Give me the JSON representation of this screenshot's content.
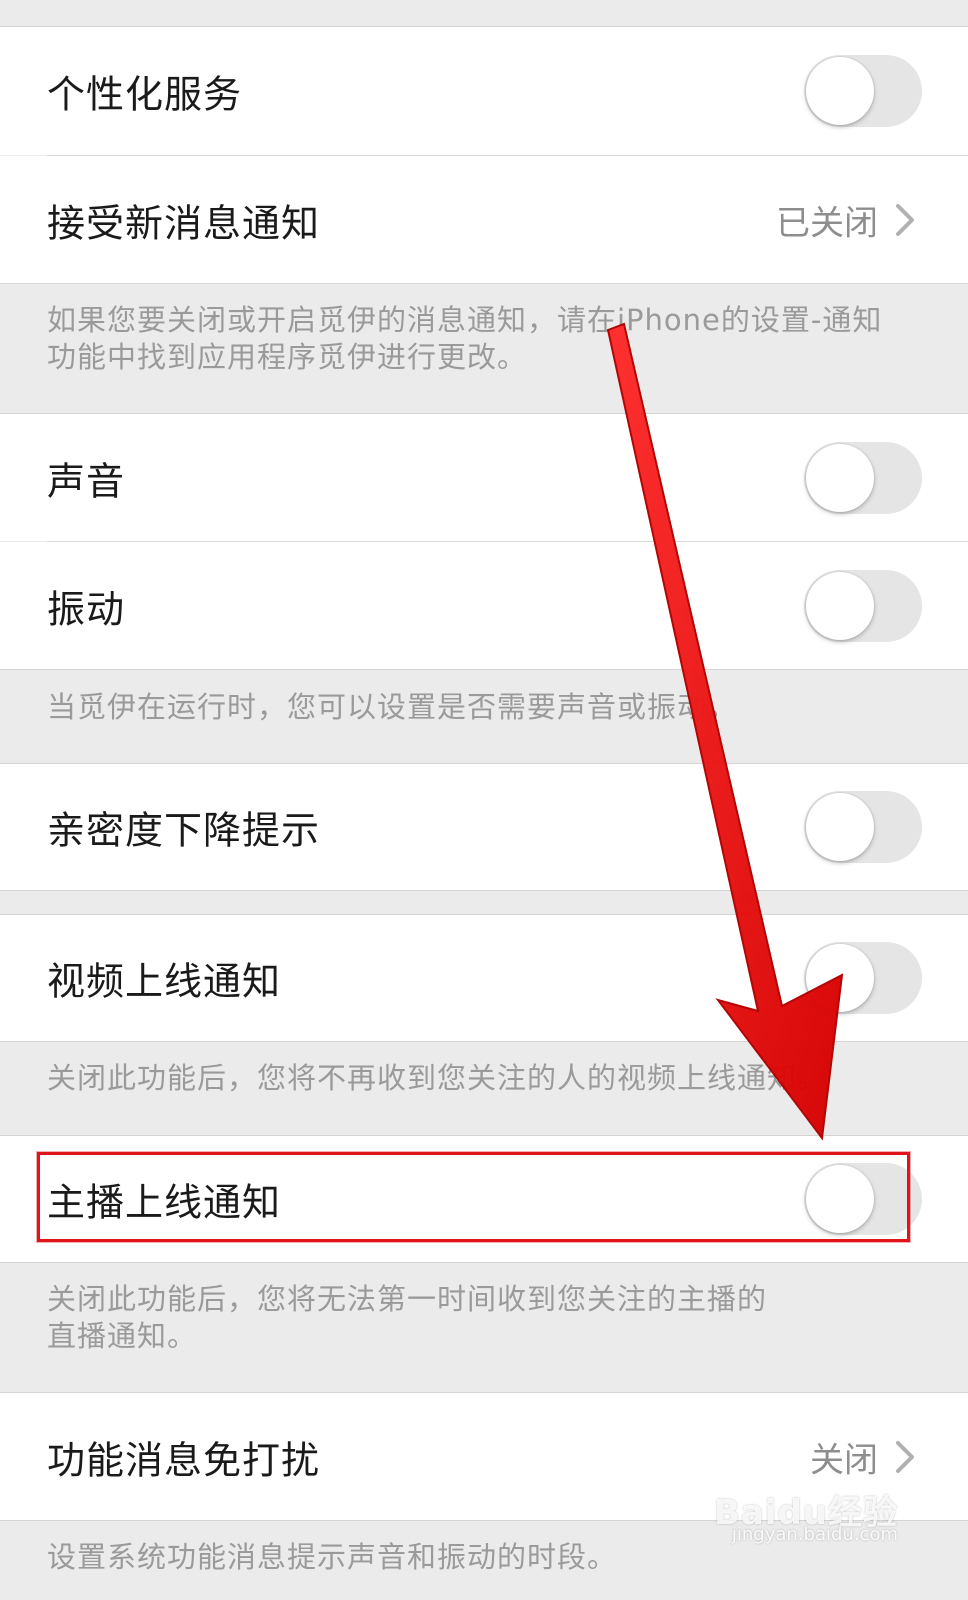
{
  "settings": {
    "personalized": {
      "label": "个性化服务"
    },
    "new_msg": {
      "label": "接受新消息通知",
      "value": "已关闭"
    },
    "note1": {
      "line1": "如果您要关闭或开启觅伊的消息通知，请在iPhone的设置-通知",
      "line2": "功能中找到应用程序觅伊进行更改。"
    },
    "sound": {
      "label": "声音"
    },
    "vibrate": {
      "label": "振动"
    },
    "note2": {
      "line1": "当觅伊在运行时，您可以设置是否需要声音或振动。"
    },
    "intimacy": {
      "label": "亲密度下降提示"
    },
    "video_online": {
      "label": "视频上线通知"
    },
    "note3": {
      "line1": "关闭此功能后，您将不再收到您关注的人的视频上线通知。"
    },
    "anchor_online": {
      "label": "主播上线通知"
    },
    "note4": {
      "line1": "关闭此功能后，您将无法第一时间收到您关注的主播的",
      "line2": "直播通知。"
    },
    "dnd": {
      "label": "功能消息免打扰",
      "value": "关闭"
    },
    "note5": {
      "line1": "设置系统功能消息提示声音和振动的时段。"
    }
  },
  "toggles": {
    "personalized": false,
    "sound": false,
    "vibrate": false,
    "intimacy": false,
    "video_online": false,
    "anchor_online": false
  },
  "watermark": {
    "brand": "Baidu经验",
    "url": "jingyan.baidu.com"
  },
  "colors": {
    "annotation_red": "#e0141c",
    "toggle_off": "#e5e5e5",
    "note_text": "#9a9a9a"
  }
}
